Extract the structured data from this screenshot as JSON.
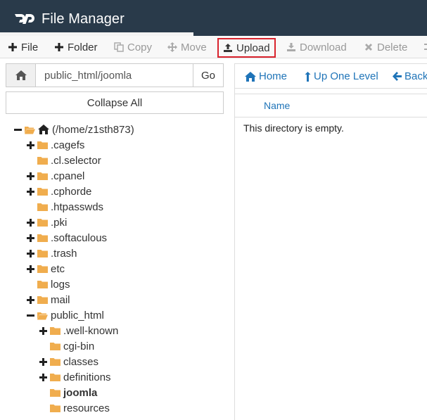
{
  "header": {
    "title": "File Manager"
  },
  "toolbar": {
    "file": "File",
    "folder": "Folder",
    "copy": "Copy",
    "move": "Move",
    "upload": "Upload",
    "download": "Download",
    "delete": "Delete"
  },
  "path": {
    "value": "public_html/joomla",
    "go": "Go"
  },
  "collapse_all": "Collapse All",
  "tree": [
    {
      "label": "(/home/z1sth873)",
      "toggle": "minus",
      "icon": "home-open"
    },
    {
      "label": ".cagefs",
      "toggle": "plus",
      "icon": "folder"
    },
    {
      "label": ".cl.selector",
      "toggle": "none",
      "icon": "folder"
    },
    {
      "label": ".cpanel",
      "toggle": "plus",
      "icon": "folder"
    },
    {
      "label": ".cphorde",
      "toggle": "plus",
      "icon": "folder"
    },
    {
      "label": ".htpasswds",
      "toggle": "none",
      "icon": "folder"
    },
    {
      "label": ".pki",
      "toggle": "plus",
      "icon": "folder"
    },
    {
      "label": ".softaculous",
      "toggle": "plus",
      "icon": "folder"
    },
    {
      "label": ".trash",
      "toggle": "plus",
      "icon": "folder"
    },
    {
      "label": "etc",
      "toggle": "plus",
      "icon": "folder"
    },
    {
      "label": "logs",
      "toggle": "none",
      "icon": "folder"
    },
    {
      "label": "mail",
      "toggle": "plus",
      "icon": "folder"
    },
    {
      "label": "public_html",
      "toggle": "minus",
      "icon": "folder-open"
    },
    {
      "label": ".well-known",
      "toggle": "plus",
      "icon": "folder"
    },
    {
      "label": "cgi-bin",
      "toggle": "none",
      "icon": "folder"
    },
    {
      "label": "classes",
      "toggle": "plus",
      "icon": "folder"
    },
    {
      "label": "definitions",
      "toggle": "plus",
      "icon": "folder"
    },
    {
      "label": "joomla",
      "toggle": "none",
      "icon": "folder",
      "selected": true
    },
    {
      "label": "resources",
      "toggle": "none",
      "icon": "folder"
    }
  ],
  "nav": {
    "home": "Home",
    "up": "Up One Level",
    "back": "Back"
  },
  "table": {
    "name_header": "Name",
    "empty_message": "This directory is empty."
  },
  "colors": {
    "header_bg": "#293a4a",
    "link": "#1f74b8",
    "folder": "#f0ad4e",
    "highlight_border": "#d9232d"
  }
}
